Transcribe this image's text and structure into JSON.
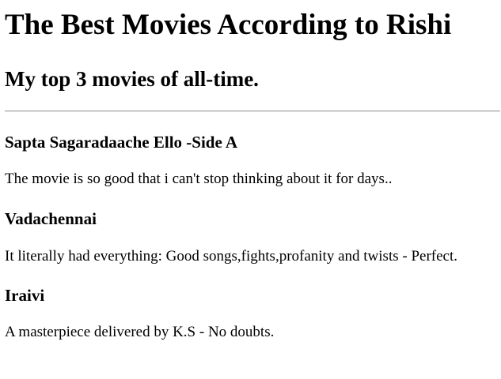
{
  "page": {
    "title": "The Best Movies According to Rishi",
    "subtitle": "My top 3 movies of all-time."
  },
  "movies": [
    {
      "title": "Sapta Sagaradaache Ello -Side A",
      "description": "The movie is so good that i can't stop thinking about it for days.."
    },
    {
      "title": "Vadachennai",
      "description": "It literally had everything: Good songs,fights,profanity and twists - Perfect."
    },
    {
      "title": "Iraivi",
      "description": "A masterpiece delivered by K.S - No doubts."
    }
  ]
}
